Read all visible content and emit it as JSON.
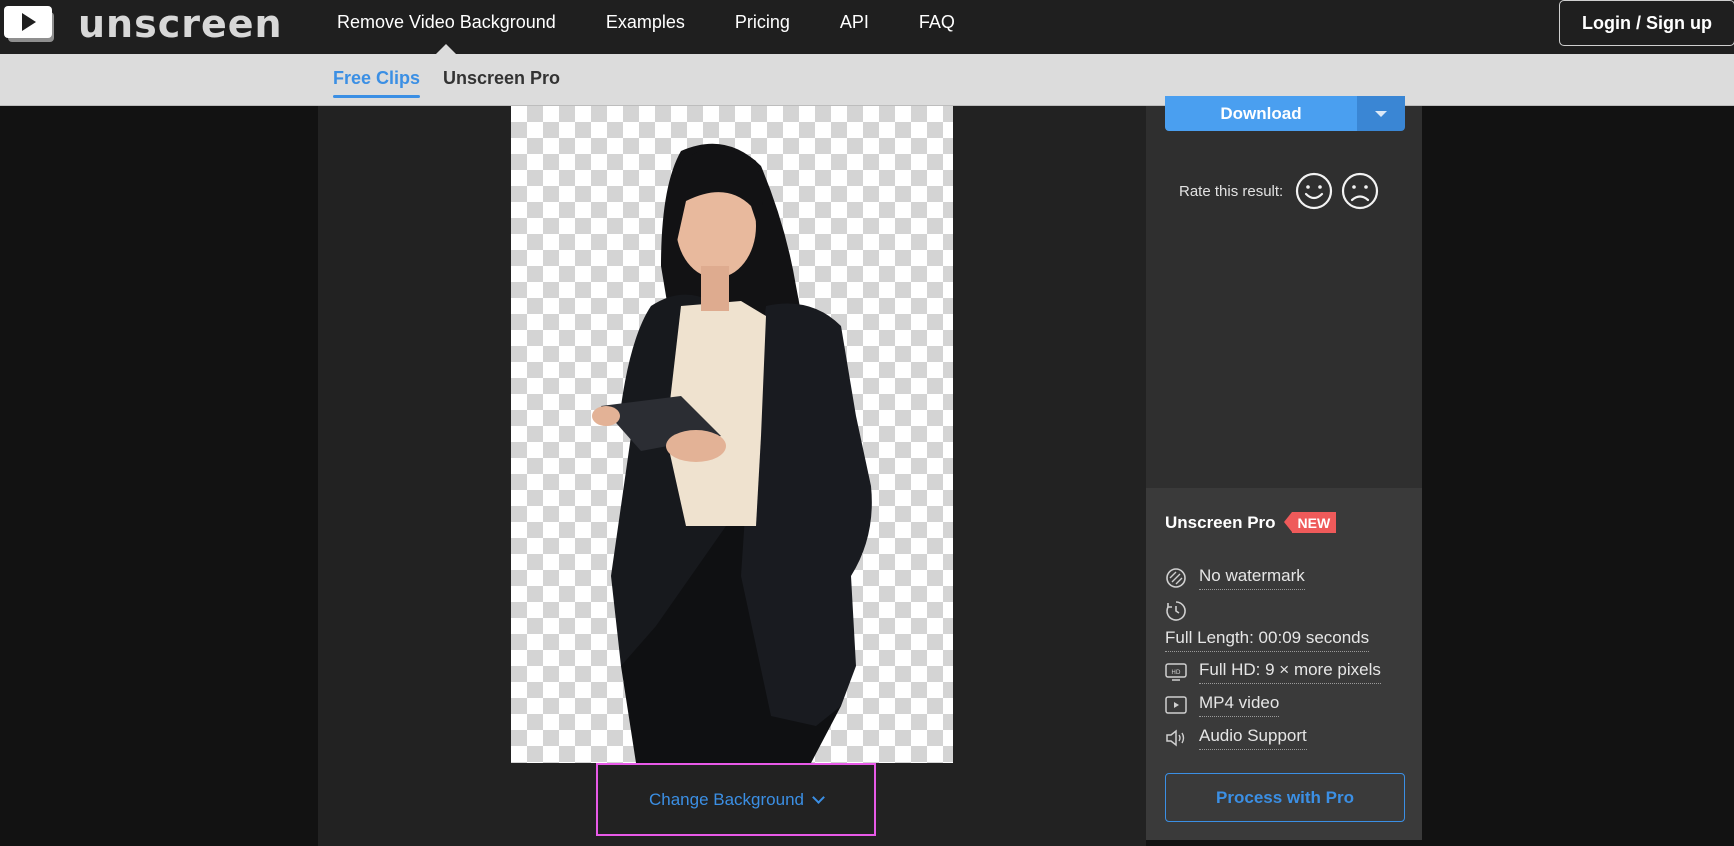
{
  "brand": {
    "name": "unscreen"
  },
  "nav": {
    "links": [
      "Remove Video Background",
      "Examples",
      "Pricing",
      "API",
      "FAQ"
    ],
    "login_label": "Login / Sign up"
  },
  "subnav": {
    "tabs": [
      "Free Clips",
      "Unscreen Pro"
    ],
    "active": "Free Clips"
  },
  "result": {
    "download_label": "Download",
    "rate_label": "Rate this result:",
    "change_bg_label": "Change Background"
  },
  "pro": {
    "title": "Unscreen Pro",
    "badge": "NEW",
    "features": [
      "No watermark",
      "Full Length: 00:09 seconds",
      "Full HD: 9 × more pixels",
      "MP4 video",
      "Audio Support"
    ],
    "process_label": "Process with Pro"
  },
  "colors": {
    "accent": "#3b8fe4",
    "badge": "#ef5a5a",
    "highlight": "#e85ae8"
  }
}
